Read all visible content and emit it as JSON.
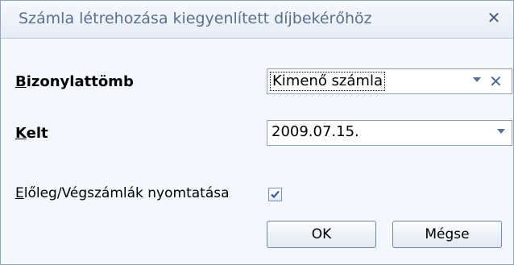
{
  "dialog": {
    "title": "Számla létrehozása kiegyenlített díjbekérőhöz",
    "close_glyph": "✕"
  },
  "fields": {
    "bizonylattomb": {
      "label_key": "B",
      "label_rest": "izonylattömb",
      "value": "Kimenő számla",
      "clear_glyph": "✕"
    },
    "kelt": {
      "label_key": "K",
      "label_rest": "elt",
      "value": "2009.07.15."
    },
    "eloleg": {
      "label_key": "E",
      "label_rest": "lőleg/Végszámlák nyomtatása",
      "checked": true
    }
  },
  "buttons": {
    "ok": "OK",
    "cancel": "Mégse"
  },
  "colors": {
    "title_text": "#5b6f8a",
    "border": "#8da2bf",
    "background": "#f4f7fb"
  }
}
